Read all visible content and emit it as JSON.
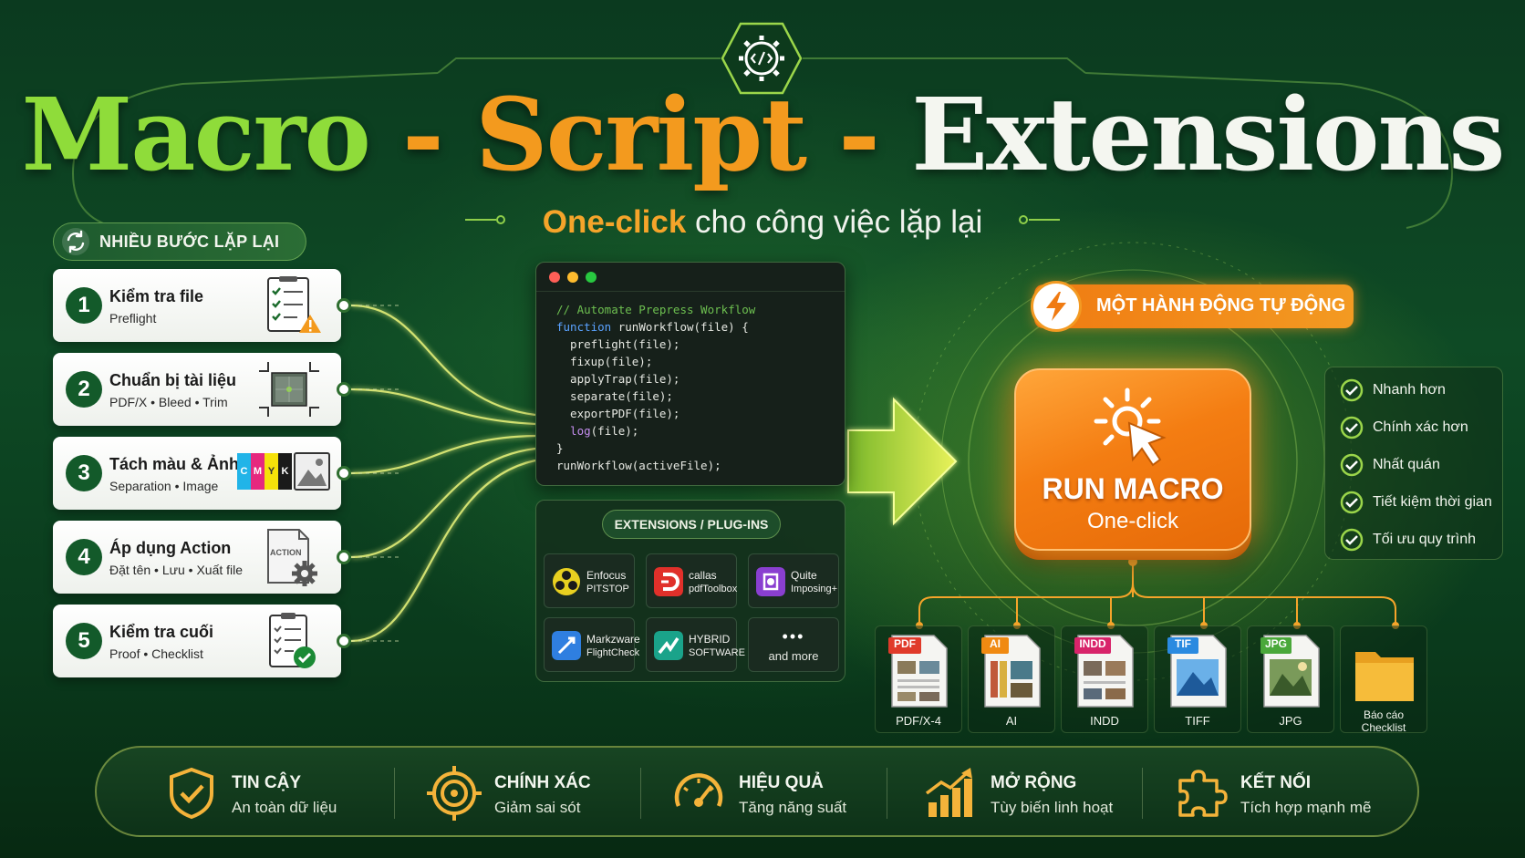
{
  "title": {
    "part1": "Macro",
    "sep1": " - ",
    "part2": "Script",
    "sep2": " - ",
    "part3": "Extensions"
  },
  "subtitle": {
    "highlight": "One-click",
    "rest": " cho công việc lặp lại"
  },
  "steps": {
    "header": "NHIỀU BƯỚC LẶP LẠI",
    "items": [
      {
        "num": "1",
        "title": "Kiểm tra file",
        "sub": "Preflight",
        "icon": "checklist-warning-icon"
      },
      {
        "num": "2",
        "title": "Chuẩn bị tài liệu",
        "sub": "PDF/X • Bleed • Trim",
        "icon": "crop-marks-icon"
      },
      {
        "num": "3",
        "title": "Tách màu & Ảnh",
        "sub": "Separation • Image",
        "icon": "cmyk-image-icon"
      },
      {
        "num": "4",
        "title": "Áp dụng Action",
        "sub": "Đặt tên • Lưu • Xuất file",
        "icon": "action-gear-icon",
        "icon_label": "ACTION"
      },
      {
        "num": "5",
        "title": "Kiểm tra cuối",
        "sub": "Proof • Checklist",
        "icon": "clipboard-check-icon"
      }
    ],
    "cmyk_letters": [
      "C",
      "M",
      "Y",
      "K"
    ]
  },
  "code": {
    "lines": [
      {
        "text": "// Automate Prepress Workflow",
        "kind": "comment"
      },
      {
        "kw": "function",
        "text": " runWorkflow(file) {",
        "kind": "kw"
      },
      {
        "text": "  preflight(file);",
        "kind": "plain"
      },
      {
        "text": "  fixup(file);",
        "kind": "plain"
      },
      {
        "text": "  applyTrap(file);",
        "kind": "plain"
      },
      {
        "text": "  separate(file);",
        "kind": "plain"
      },
      {
        "text": "  exportPDF(file);",
        "kind": "plain"
      },
      {
        "log": "  log",
        "text": "(file);",
        "kind": "log"
      },
      {
        "text": "}",
        "kind": "plain"
      },
      {
        "text": "runWorkflow(activeFile);",
        "kind": "plain"
      }
    ]
  },
  "extensions": {
    "header": "EXTENSIONS / PLUG-INS",
    "tiles": [
      {
        "line1": "Enfocus",
        "line2": "PITSTOP",
        "logo_color": "#e8d020"
      },
      {
        "line1": "callas",
        "line2": "pdfToolbox",
        "logo_color": "#e0302a"
      },
      {
        "line1": "Quite",
        "line2": "Imposing+",
        "logo_color": "#8a3fd0"
      },
      {
        "line1": "Markzware",
        "line2": "FlightCheck",
        "logo_color": "#2f7fe0"
      },
      {
        "line1": "HYBRID",
        "line2": "SOFTWARE",
        "logo_color": "#1aa38a"
      }
    ],
    "more_dots": "•••",
    "more_text": "and more"
  },
  "action_badge": {
    "text": "MỘT HÀNH ĐỘNG TỰ ĐỘNG",
    "icon": "lightning-icon"
  },
  "run_macro": {
    "title": "RUN MACRO",
    "sub": "One-click",
    "icon": "cursor-click-icon"
  },
  "benefits": [
    "Nhanh hơn",
    "Chính xác hơn",
    "Nhất quán",
    "Tiết kiệm thời gian",
    "Tối ưu quy trình"
  ],
  "outputs": [
    {
      "tag": "PDF",
      "label": "PDF/X-4",
      "tag_color": "#e03a2a"
    },
    {
      "tag": "AI",
      "label": "AI",
      "tag_color": "#f08a12"
    },
    {
      "tag": "INDD",
      "label": "INDD",
      "tag_color": "#d8246a"
    },
    {
      "tag": "TIF",
      "label": "TIFF",
      "tag_color": "#2a8ae0"
    },
    {
      "tag": "JPG",
      "label": "JPG",
      "tag_color": "#4aa83a"
    },
    {
      "tag": "",
      "label": "Báo cáo",
      "label2": "Checklist",
      "tag_color": "#f0b030"
    }
  ],
  "features": [
    {
      "title": "TIN CẬY",
      "sub": "An toàn dữ liệu",
      "icon": "shield-check-icon"
    },
    {
      "title": "CHÍNH XÁC",
      "sub": "Giảm sai sót",
      "icon": "target-icon"
    },
    {
      "title": "HIỆU QUẢ",
      "sub": "Tăng năng suất",
      "icon": "gauge-icon"
    },
    {
      "title": "MỞ RỘNG",
      "sub": "Tùy biến linh hoạt",
      "icon": "growth-chart-icon"
    },
    {
      "title": "KẾT NỐI",
      "sub": "Tích hợp mạnh mẽ",
      "icon": "puzzle-icon"
    }
  ],
  "colors": {
    "green_accent": "#8fdc3a",
    "orange_accent": "#f39a1e",
    "dark_green": "#135a2a"
  }
}
